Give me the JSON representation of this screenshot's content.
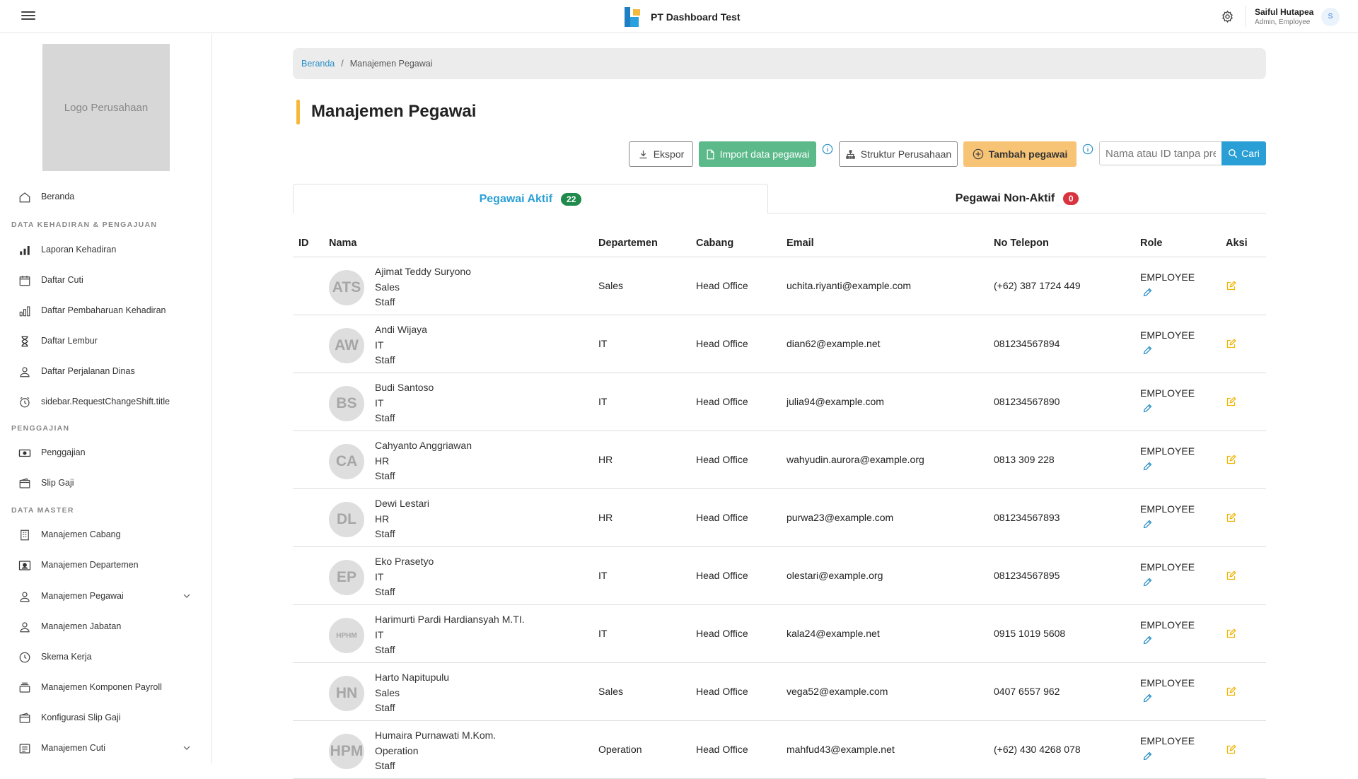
{
  "app": {
    "title": "PT Dashboard Test"
  },
  "user": {
    "name": "Saiful Hutapea",
    "role": "Admin, Employee",
    "initial": "S"
  },
  "sidebar": {
    "logo_text": "Logo Perusahaan",
    "items": [
      {
        "label": "Beranda",
        "icon": "home-icon"
      },
      {
        "section": "DATA KEHADIRAN & PENGAJUAN"
      },
      {
        "label": "Laporan Kehadiran",
        "icon": "bar-chart-icon"
      },
      {
        "label": "Daftar Cuti",
        "icon": "calendar-icon"
      },
      {
        "label": "Daftar Pembaharuan Kehadiran",
        "icon": "bar-chart-outline-icon"
      },
      {
        "label": "Daftar Lembur",
        "icon": "hourglass-icon"
      },
      {
        "label": "Daftar Perjalanan Dinas",
        "icon": "user-icon"
      },
      {
        "label": "sidebar.RequestChangeShift.title",
        "icon": "alarm-icon"
      },
      {
        "section": "PENGGAJIAN"
      },
      {
        "label": "Penggajian",
        "icon": "money-icon"
      },
      {
        "label": "Slip Gaji",
        "icon": "wallet-icon"
      },
      {
        "section": "DATA MASTER"
      },
      {
        "label": "Manajemen Cabang",
        "icon": "building-icon"
      },
      {
        "label": "Manajemen Departemen",
        "icon": "id-card-icon"
      },
      {
        "label": "Manajemen Pegawai",
        "icon": "user-icon",
        "expandable": true
      },
      {
        "label": "Manajemen Jabatan",
        "icon": "user-icon"
      },
      {
        "label": "Skema Kerja",
        "icon": "clock-icon"
      },
      {
        "label": "Manajemen Komponen Payroll",
        "icon": "stack-icon"
      },
      {
        "label": "Konfigurasi Slip Gaji",
        "icon": "wallet-icon"
      },
      {
        "label": "Manajemen Cuti",
        "icon": "list-icon",
        "expandable": true
      }
    ]
  },
  "breadcrumb": {
    "home": "Beranda",
    "separator": "/",
    "current": "Manajemen Pegawai"
  },
  "page": {
    "title": "Manajemen Pegawai"
  },
  "toolbar": {
    "export_label": "Ekspor",
    "import_label": "Import data pegawai",
    "structure_label": "Struktur Perusahaan",
    "add_label": "Tambah pegawai",
    "search_placeholder": "Nama atau ID tanpa prefix",
    "search_button": "Cari"
  },
  "tabs": [
    {
      "label": "Pegawai Aktif",
      "count": "22",
      "active": true
    },
    {
      "label": "Pegawai Non-Aktif",
      "count": "0",
      "active": false
    }
  ],
  "table": {
    "columns": [
      "ID",
      "Nama",
      "Departemen",
      "Cabang",
      "Email",
      "No Telepon",
      "Role",
      "Aksi"
    ],
    "rows": [
      {
        "initials": "ATS",
        "name": "Ajimat Teddy Suryono",
        "dept": "Sales",
        "position": "Staff",
        "branch": "Head Office",
        "email": "uchita.riyanti@example.com",
        "phone": "(+62) 387 1724 449",
        "role": "EMPLOYEE"
      },
      {
        "initials": "AW",
        "name": "Andi Wijaya",
        "dept": "IT",
        "position": "Staff",
        "branch": "Head Office",
        "email": "dian62@example.net",
        "phone": "081234567894",
        "role": "EMPLOYEE"
      },
      {
        "initials": "BS",
        "name": "Budi Santoso",
        "dept": "IT",
        "position": "Staff",
        "branch": "Head Office",
        "email": "julia94@example.com",
        "phone": "081234567890",
        "role": "EMPLOYEE"
      },
      {
        "initials": "CA",
        "name": "Cahyanto Anggriawan",
        "dept": "HR",
        "position": "Staff",
        "branch": "Head Office",
        "email": "wahyudin.aurora@example.org",
        "phone": "0813 309 228",
        "role": "EMPLOYEE"
      },
      {
        "initials": "DL",
        "name": "Dewi Lestari",
        "dept": "HR",
        "position": "Staff",
        "branch": "Head Office",
        "email": "purwa23@example.com",
        "phone": "081234567893",
        "role": "EMPLOYEE"
      },
      {
        "initials": "EP",
        "name": "Eko Prasetyo",
        "dept": "IT",
        "position": "Staff",
        "branch": "Head Office",
        "email": "olestari@example.org",
        "phone": "081234567895",
        "role": "EMPLOYEE"
      },
      {
        "initials": "HPHM",
        "name": "Harimurti Pardi Hardiansyah M.TI.",
        "dept": "IT",
        "position": "Staff",
        "branch": "Head Office",
        "email": "kala24@example.net",
        "phone": "0915 1019 5608",
        "role": "EMPLOYEE"
      },
      {
        "initials": "HN",
        "name": "Harto Napitupulu",
        "dept": "Sales",
        "position": "Staff",
        "branch": "Head Office",
        "email": "vega52@example.com",
        "phone": "0407 6557 962",
        "role": "EMPLOYEE"
      },
      {
        "initials": "HPM",
        "name": "Humaira Purnawati M.Kom.",
        "dept": "Operation",
        "position": "Staff",
        "branch": "Head Office",
        "email": "mahfud43@example.net",
        "phone": "(+62) 430 4268 078",
        "role": "EMPLOYEE"
      }
    ]
  },
  "colors": {
    "accent": "#2a9fd6",
    "import": "#5cb98a",
    "add": "#f7c476",
    "title_bar": "#f5b83d",
    "badge_active": "#1f8a4c",
    "badge_inactive": "#d9333f"
  }
}
